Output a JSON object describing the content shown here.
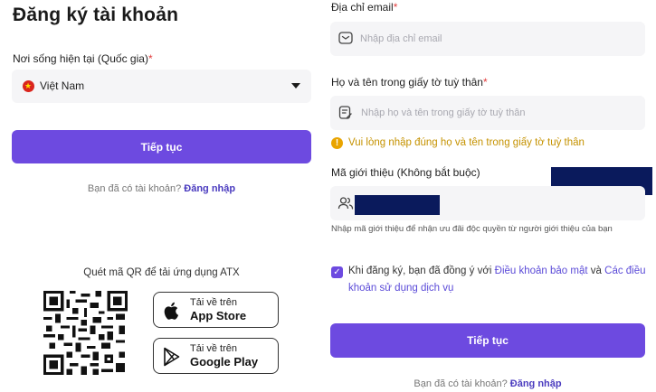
{
  "left": {
    "title": "Đăng ký tài khoản",
    "country_label": "Nơi sống hiện tại (Quốc gia)",
    "required_mark": "*",
    "country_value": "Việt Nam",
    "continue_label": "Tiếp tục",
    "have_account_text": "Bạn đã có tài khoản?",
    "login_link": "Đăng nhập",
    "qr_caption": "Quét mã QR để tải ứng dụng ATX",
    "app_store": {
      "line1": "Tải về trên",
      "line2": "App Store"
    },
    "google_play": {
      "line1": "Tải về trên",
      "line2": "Google Play"
    }
  },
  "right": {
    "email_label": "Địa chỉ email",
    "required_mark": "*",
    "email_placeholder": "Nhập địa chỉ email",
    "fullname_label": "Họ và tên trong giấy tờ tuỳ thân",
    "fullname_placeholder": "Nhập họ và tên trong giấy tờ tuỳ thân",
    "warning_text": "Vui lòng nhập đúng họ và tên trong giấy tờ tuỳ thân",
    "referral_label": "Mã giới thiệu (Không bắt buộc)",
    "referral_hint": "Nhập mã giới thiệu để nhận ưu đãi độc quyền từ người giới thiệu của bạn",
    "terms_prefix": "Khi đăng ký, bạn đã đồng ý với",
    "terms_link1": "Điều khoản bảo mật",
    "terms_and": "và",
    "terms_link2": "Các điều khoản sử dụng dịch vụ",
    "continue_label": "Tiếp tục",
    "have_account_text": "Bạn đã có tài khoản?",
    "login_link": "Đăng nhập"
  },
  "colors": {
    "accent": "#6d4ae0",
    "warning": "#e9a400",
    "required": "#e23d3d",
    "redaction": "#0a1a5c"
  },
  "icons": [
    "vietnam-flag-icon",
    "chevron-down-icon",
    "mail-icon",
    "id-card-icon",
    "warning-icon",
    "users-icon",
    "checkbox-checked-icon",
    "apple-icon",
    "google-play-icon",
    "qr-code"
  ]
}
